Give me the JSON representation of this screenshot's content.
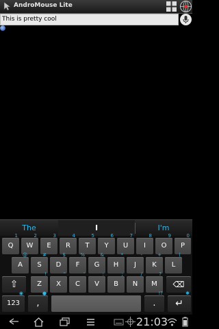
{
  "window": {
    "title": "AndroMouse Lite"
  },
  "textfield": {
    "value": "This is pretty cool"
  },
  "suggestions": [
    "The",
    "I",
    "I'm"
  ],
  "keyboard": {
    "row1": [
      {
        "label": "Q",
        "hint": "1"
      },
      {
        "label": "W",
        "hint": "2"
      },
      {
        "label": "E",
        "hint": "3"
      },
      {
        "label": "R",
        "hint": "4"
      },
      {
        "label": "T",
        "hint": "5"
      },
      {
        "label": "Y",
        "hint": "6"
      },
      {
        "label": "U",
        "hint": "7"
      },
      {
        "label": "I",
        "hint": "8"
      },
      {
        "label": "O",
        "hint": "9"
      },
      {
        "label": "P",
        "hint": "0"
      }
    ],
    "row2": [
      {
        "label": "A",
        "hint": "@"
      },
      {
        "label": "S",
        "hint": "#"
      },
      {
        "label": "D",
        "hint": "$"
      },
      {
        "label": "F",
        "hint": "%"
      },
      {
        "label": "G",
        "hint": "&"
      },
      {
        "label": "H",
        "hint": "*"
      },
      {
        "label": "J",
        "hint": "-"
      },
      {
        "label": "K",
        "hint": "+"
      },
      {
        "label": "L",
        "hint": "("
      }
    ],
    "row3": [
      {
        "label": "Z",
        "hint": "!"
      },
      {
        "label": "X",
        "hint": "\""
      },
      {
        "label": "C",
        "hint": "'"
      },
      {
        "label": "V",
        "hint": ":"
      },
      {
        "label": "B",
        "hint": ";"
      },
      {
        "label": "N",
        "hint": "/"
      },
      {
        "label": "M",
        "hint": "?"
      }
    ],
    "shift": "⇧",
    "delete": "⌫",
    "numbers": "123",
    "comma": ",",
    "period": ".",
    "period_hint": "!?",
    "enter": "↵"
  },
  "status": {
    "time": "21:03"
  },
  "icons": {
    "app": "mouse-pointer-icon",
    "grid": "grid-icon",
    "globe": "globe-icon",
    "mic": "mic-icon",
    "back": "back-icon",
    "home": "home-icon",
    "recent": "recent-apps-icon",
    "menu": "menu-icon"
  },
  "colors": {
    "accent": "#33b5e5",
    "key": "#4a4a4a",
    "background": "#000000"
  }
}
